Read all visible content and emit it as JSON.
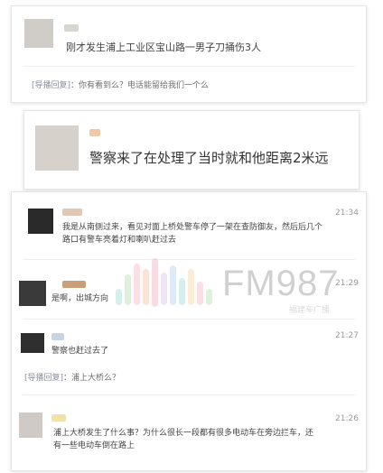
{
  "comments": [
    {
      "text": "刚才发生浦上工业区宝山路一男子刀捅伤3人"
    },
    {
      "text": "警察来了在处理了当时就和他距离2米远"
    },
    {
      "time": "21:34",
      "text": "我是从南侧过来，看见对面上桥处警车停了一架在查防御友，然后后几个",
      "text2": "路口有警车亮着灯和喇叭赶过去"
    },
    {
      "time": "21:29",
      "text": "是啊，出城方向"
    },
    {
      "time": "21:27",
      "text": "警察也赶过去了"
    },
    {
      "time": "21:26",
      "text": "浦上大桥发生了什么事？为什么很长一段都有很多电动车在旁边拦车，还",
      "text2": "有一些电动车倒在路上"
    }
  ],
  "replies": [
    {
      "tag": "[导播回复]",
      "text": "：你有看到么？电话能留给我们一个么"
    },
    {
      "tag": "[导播回复]",
      "text": "：浦上大桥么？"
    }
  ],
  "watermark": {
    "text": "FM987",
    "sub": "福建车广播"
  }
}
